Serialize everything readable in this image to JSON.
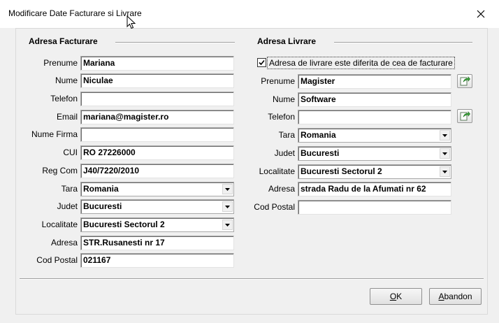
{
  "window": {
    "title": "Modificare Date Facturare si Livrare"
  },
  "billing": {
    "section_title": "Adresa Facturare",
    "labels": {
      "prenume": "Prenume",
      "nume": "Nume",
      "telefon": "Telefon",
      "email": "Email",
      "firma": "Nume Firma",
      "cui": "CUI",
      "regcom": "Reg Com",
      "tara": "Tara",
      "judet": "Judet",
      "localitate": "Localitate",
      "adresa": "Adresa",
      "codpostal": "Cod Postal"
    },
    "values": {
      "prenume": "Mariana",
      "nume": "Niculae",
      "telefon": "",
      "email": "mariana@magister.ro",
      "firma": "",
      "cui": "RO 27226000",
      "regcom": "J40/7220/2010",
      "tara": "Romania",
      "judet": "Bucuresti",
      "localitate": "Bucuresti Sectorul 2",
      "adresa": "STR.Rusanesti nr 17",
      "codpostal": "021167"
    }
  },
  "shipping": {
    "section_title": "Adresa Livrare",
    "different_checkbox": {
      "label": "Adresa de livrare este diferita de cea de facturare",
      "checked": true
    },
    "labels": {
      "prenume": "Prenume",
      "nume": "Nume",
      "telefon": "Telefon",
      "tara": "Tara",
      "judet": "Judet",
      "localitate": "Localitate",
      "adresa": "Adresa",
      "codpostal": "Cod Postal"
    },
    "values": {
      "prenume": "Magister",
      "nume": "Software",
      "telefon": "",
      "tara": "Romania",
      "judet": "Bucuresti",
      "localitate": "Bucuresti Sectorul 2",
      "adresa": "strada Radu de la Afumati nr 62",
      "codpostal": ""
    }
  },
  "buttons": {
    "ok_accel": "O",
    "ok_rest": "K",
    "cancel_accel": "A",
    "cancel_rest": "bandon"
  },
  "icons": {
    "close": "close-icon",
    "copy": "copy-green-arrow-icon",
    "dropdown": "chevron-down-icon",
    "cursor": "mouse-cursor-icon"
  }
}
